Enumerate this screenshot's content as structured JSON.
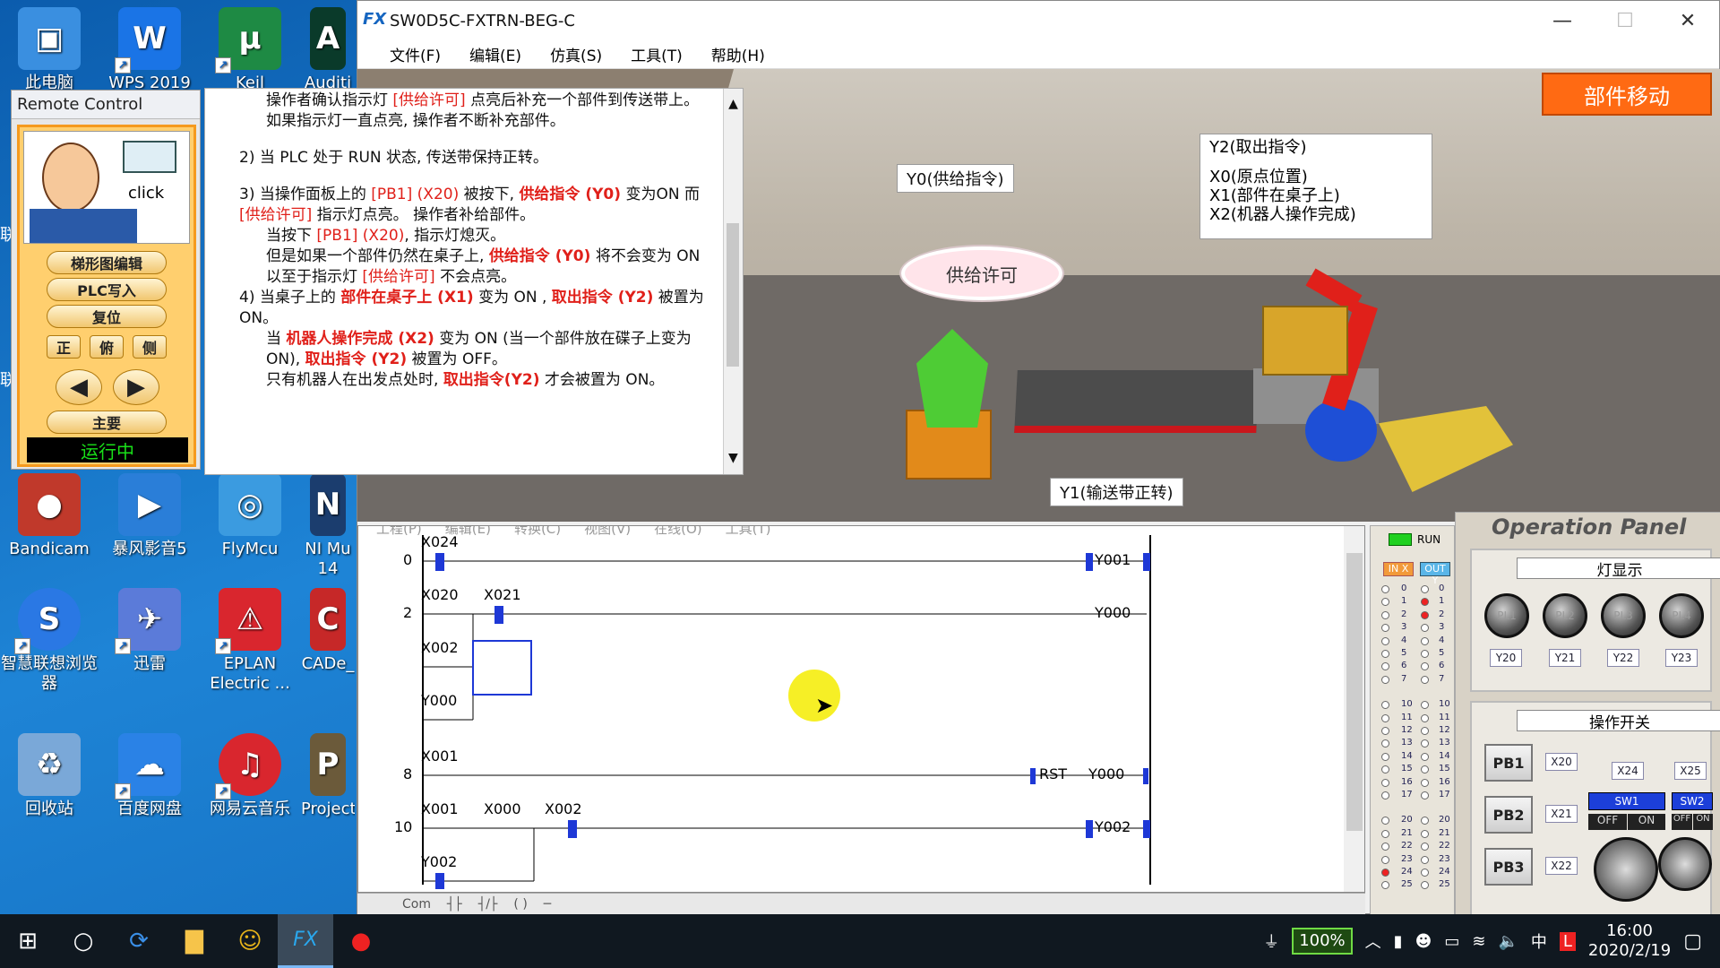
{
  "desktop": {
    "icons": [
      {
        "label": "此电脑",
        "color": "#3a8fe0",
        "glyph": "▣"
      },
      {
        "label": "WPS 2019",
        "color": "#1a74e6",
        "glyph": "W"
      },
      {
        "label": "Keil",
        "color": "#1e8a44",
        "glyph": "μ"
      },
      {
        "label": "Auditi",
        "color": "#0a3a2a",
        "glyph": "A"
      },
      {
        "label": "Bandicam",
        "color": "#c0392b",
        "glyph": "●"
      },
      {
        "label": "暴风影音5",
        "color": "#2a7ed8",
        "glyph": "▶"
      },
      {
        "label": "FlyMcu",
        "color": "#3b9be0",
        "glyph": "◎"
      },
      {
        "label": "NI Mu 14",
        "color": "#1b3d6e",
        "glyph": "N"
      },
      {
        "label": "智慧联想浏览器",
        "color": "#2a78e4",
        "glyph": "S"
      },
      {
        "label": "迅雷",
        "color": "#5b7bd9",
        "glyph": "✈"
      },
      {
        "label": "EPLAN Electric ...",
        "color": "#d9262e",
        "glyph": "⚠"
      },
      {
        "label": "CADe_",
        "color": "#c62828",
        "glyph": "C"
      },
      {
        "label": "回收站",
        "color": "#7aa8d8",
        "glyph": "♻"
      },
      {
        "label": "百度网盘",
        "color": "#2a82e6",
        "glyph": "☁"
      },
      {
        "label": "网易云音乐",
        "color": "#d9262e",
        "glyph": "♫"
      },
      {
        "label": "Project",
        "color": "#6b5a3a",
        "glyph": "P"
      }
    ],
    "side_labels": [
      "联",
      "联"
    ]
  },
  "window": {
    "title": "SW0D5C-FXTRN-BEG-C",
    "logo": "FX",
    "controls": [
      "—",
      "☐",
      "✕"
    ],
    "menu": [
      "文件(F)",
      "编辑(E)",
      "仿真(S)",
      "工具(T)",
      "帮助(H)"
    ]
  },
  "scene": {
    "move_button": "部件移动",
    "label_y0": "Y0(供给指令)",
    "label_y1": "Y1(输送带正转)",
    "info_lines": [
      "Y2(取出指令)",
      "",
      "X0(原点位置)",
      "X1(部件在桌子上)",
      "X2(机器人操作完成)"
    ],
    "permit_lamp": "供给许可"
  },
  "remote": {
    "title": "Remote Control",
    "face_text": "click",
    "buttons": [
      "梯形图编辑",
      "PLC写入",
      "复位"
    ],
    "views": [
      "正",
      "俯",
      "侧"
    ],
    "prev": "◀",
    "next": "▶",
    "main": "主要",
    "status": "运行中"
  },
  "instructions": {
    "p1": [
      {
        "t": "操作者确认指示灯 ",
        "c": ""
      },
      {
        "t": "[供给许可]",
        "c": "red"
      },
      {
        "t": " 点亮后补充一个部件到传送带上。",
        "c": ""
      }
    ],
    "p1b": "如果指示灯一直点亮, 操作者不断补充部件。",
    "p2": "2) 当 PLC 处于 RUN 状态, 传送带保持正转。",
    "p3": [
      {
        "t": "3) 当操作面板上的 ",
        "c": ""
      },
      {
        "t": "[PB1] (X20)",
        "c": "red"
      },
      {
        "t": " 被按下, ",
        "c": ""
      },
      {
        "t": "供给指令 (Y0)",
        "c": "redb"
      },
      {
        "t": " 变为ON 而 ",
        "c": ""
      },
      {
        "t": "[供给许可]",
        "c": "red"
      },
      {
        "t": " 指示灯点亮。 操作者补给部件。",
        "c": ""
      }
    ],
    "p3b": [
      {
        "t": "当按下 ",
        "c": ""
      },
      {
        "t": "[PB1] (X20)",
        "c": "red"
      },
      {
        "t": ", 指示灯熄灭。",
        "c": ""
      }
    ],
    "p3c": [
      {
        "t": "但是如果一个部件仍然在桌子上, ",
        "c": ""
      },
      {
        "t": "供给指令 (Y0)",
        "c": "redb"
      },
      {
        "t": " 将不会变为 ON 以至于指示灯 ",
        "c": ""
      },
      {
        "t": "[供给许可]",
        "c": "red"
      },
      {
        "t": " 不会点亮。",
        "c": ""
      }
    ],
    "p4": [
      {
        "t": "4) 当桌子上的 ",
        "c": ""
      },
      {
        "t": "部件在桌子上 (X1)",
        "c": "redb"
      },
      {
        "t": " 变为 ON , ",
        "c": ""
      },
      {
        "t": "取出指令 (Y2)",
        "c": "redb"
      },
      {
        "t": " 被置为 ON。",
        "c": ""
      }
    ],
    "p4b": [
      {
        "t": "当 ",
        "c": ""
      },
      {
        "t": "机器人操作完成 (X2)",
        "c": "redb"
      },
      {
        "t": " 变为 ON (当一个部件放在碟子上变为 ON), ",
        "c": ""
      },
      {
        "t": "取出指令 (Y2)",
        "c": "redb"
      },
      {
        "t": " 被置为 OFF。",
        "c": ""
      }
    ],
    "p4c": [
      {
        "t": "只有机器人在出发点处时, ",
        "c": ""
      },
      {
        "t": "取出指令(Y2)",
        "c": "redb"
      },
      {
        "t": " 才会被置为 ON。",
        "c": ""
      }
    ]
  },
  "ladder": {
    "hidden_menu": [
      "工程(P)",
      "编辑(E)",
      "转换(C)",
      "视图(V)",
      "在线(O)",
      "工具(T)"
    ],
    "step_numbers": [
      "0",
      "2",
      "8",
      "10"
    ],
    "contacts": [
      "X024",
      "X020",
      "X021",
      "X002",
      "Y000",
      "X001",
      "X001",
      "X000",
      "X002",
      "Y002"
    ],
    "coils": [
      "Y001",
      "Y000",
      "Y000",
      "Y002"
    ],
    "rst_label": "RST",
    "toolbar_label": "Com"
  },
  "io": {
    "run_label": "RUN",
    "in_header": "IN X",
    "out_header": "OUT Y",
    "rows": [
      "0",
      "1",
      "2",
      "3",
      "4",
      "5",
      "6",
      "7",
      "10",
      "11",
      "12",
      "13",
      "14",
      "15",
      "16",
      "17",
      "20",
      "21",
      "22",
      "23",
      "24",
      "25"
    ],
    "out_on": [
      "1",
      "2"
    ],
    "in_on": [
      "24"
    ]
  },
  "operation_panel": {
    "title": "Operation Panel",
    "lamp_section": "灯显示",
    "lamps": [
      {
        "label": "PL1",
        "tag": "Y20"
      },
      {
        "label": "PL2",
        "tag": "Y21"
      },
      {
        "label": "PL3",
        "tag": "Y22"
      },
      {
        "label": "PL4",
        "tag": "Y23"
      }
    ],
    "switch_section": "操作开关",
    "pushbuttons": [
      {
        "label": "PB1",
        "tag": "X20"
      },
      {
        "label": "PB2",
        "tag": "X21"
      },
      {
        "label": "PB3",
        "tag": "X22"
      }
    ],
    "switch_tags": [
      "X24",
      "X25"
    ],
    "switches": [
      {
        "label": "SW1",
        "off": "OFF",
        "on": "ON"
      },
      {
        "label": "SW2",
        "off": "OFF",
        "on": "ON"
      }
    ]
  },
  "taskbar": {
    "battery": "100%",
    "ime": "中",
    "time": "16:00",
    "date": "2020/2/19"
  }
}
